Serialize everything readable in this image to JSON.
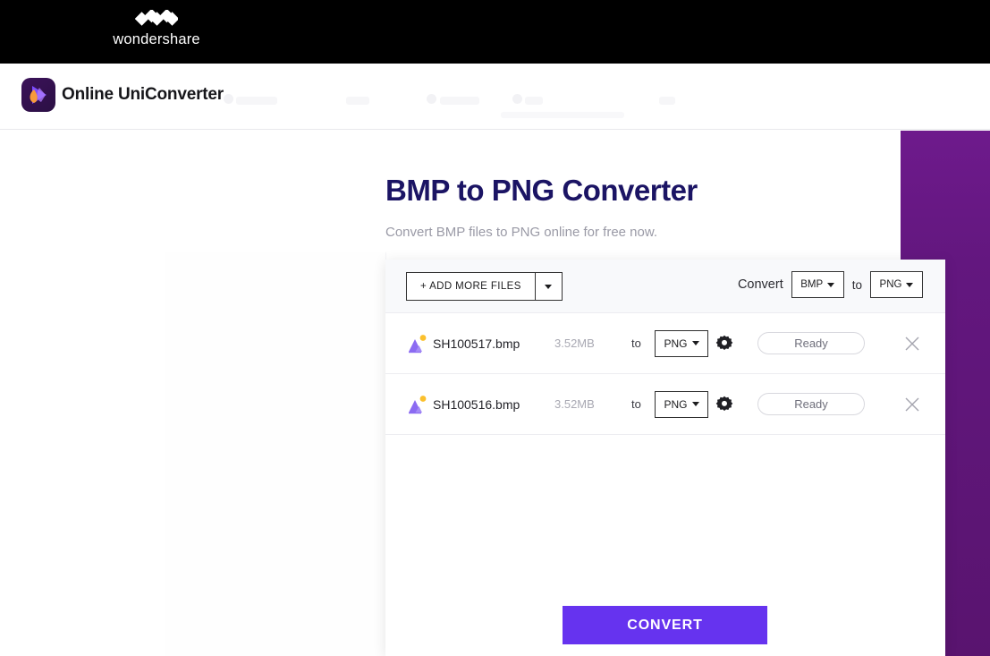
{
  "brand": {
    "logo_icon": "wondershare-w-mark",
    "name": "wondershare"
  },
  "product_header": {
    "logo_icon": "uniconverter-logo-icon",
    "title": "Online UniConverter"
  },
  "hero": {
    "title": "BMP to PNG Converter",
    "subtitle": "Convert BMP files to PNG online for free now."
  },
  "toolbar": {
    "add_files_label": "+ ADD MORE FILES",
    "dropdown_icon": "chevron-down-icon",
    "convert_label": "Convert",
    "source_format": "BMP",
    "to_label": "to",
    "target_format": "PNG"
  },
  "files": [
    {
      "icon": "image-file-icon",
      "name": "SH100517.bmp",
      "size": "3.52MB",
      "to_label": "to",
      "format": "PNG",
      "settings_icon": "gear-icon",
      "status": "Ready",
      "remove_icon": "close-icon"
    },
    {
      "icon": "image-file-icon",
      "name": "SH100516.bmp",
      "size": "3.52MB",
      "to_label": "to",
      "format": "PNG",
      "settings_icon": "gear-icon",
      "status": "Ready",
      "remove_icon": "close-icon"
    }
  ],
  "actions": {
    "convert_button": "CONVERT"
  },
  "colors": {
    "accent_purple": "#6633ef",
    "panel_purple": "#63177f",
    "title_navy": "#1b1464",
    "brand_black": "#000000"
  }
}
